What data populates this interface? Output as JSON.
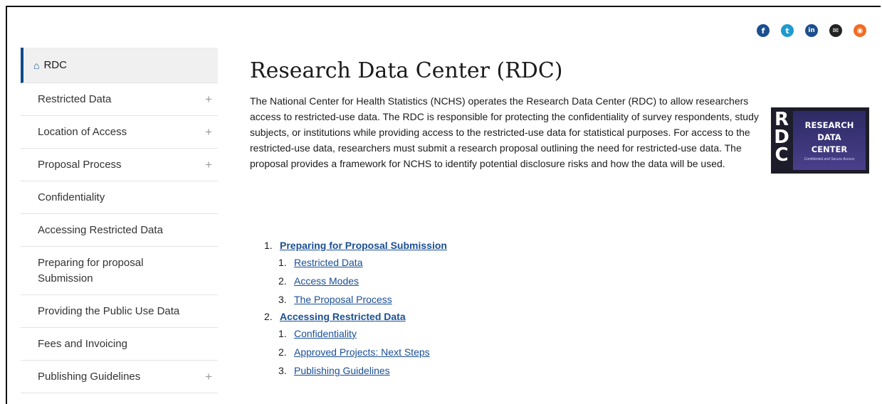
{
  "share": {
    "icons": [
      "facebook-icon",
      "twitter-icon",
      "linkedin-icon",
      "email-icon",
      "rss-icon"
    ]
  },
  "sidebar": {
    "items": [
      {
        "label": "RDC",
        "active": true,
        "expandable": false
      },
      {
        "label": "Restricted Data",
        "active": false,
        "expandable": true
      },
      {
        "label": "Location of Access",
        "active": false,
        "expandable": true
      },
      {
        "label": "Proposal Process",
        "active": false,
        "expandable": true
      },
      {
        "label": "Confidentiality",
        "active": false,
        "expandable": false
      },
      {
        "label": "Accessing Restricted Data",
        "active": false,
        "expandable": false
      },
      {
        "label": "Preparing for proposal Submission",
        "active": false,
        "expandable": false
      },
      {
        "label": "Providing the Public Use Data",
        "active": false,
        "expandable": false
      },
      {
        "label": "Fees and Invoicing",
        "active": false,
        "expandable": false
      },
      {
        "label": "Publishing Guidelines",
        "active": false,
        "expandable": true
      }
    ],
    "plus_symbol": "+"
  },
  "main": {
    "title": "Research Data Center (RDC)",
    "intro": "The National Center for Health Statistics (NCHS) operates the Research Data Center (RDC) to allow researchers access to restricted-use data. The RDC is responsible for protecting the confidentiality of survey respondents, study subjects, or institutions while providing access to the restricted-use data for statistical purposes. For access to the restricted-use data, researchers must submit a research proposal outlining the need for restricted-use data. The proposal provides a framework for NCHS to identify potential disclosure risks and how the data will be used.",
    "badge": {
      "letters": [
        "R",
        "D",
        "C"
      ],
      "line1": "RESEARCH",
      "line2": "DATA",
      "line3": "CENTER",
      "subtitle": "Confidential and Secure Access"
    },
    "toc": [
      {
        "num": "1.",
        "label": "Preparing for Proposal Submission",
        "children": [
          {
            "num": "1.",
            "label": "Restricted Data"
          },
          {
            "num": "2.",
            "label": "Access Modes"
          },
          {
            "num": "3.",
            "label": "The Proposal Process"
          }
        ]
      },
      {
        "num": "2.",
        "label": "Accessing Restricted Data",
        "children": [
          {
            "num": "1.",
            "label": "Confidentiality"
          },
          {
            "num": "2.",
            "label": "Approved Projects: Next Steps"
          },
          {
            "num": "3.",
            "label": "Publishing Guidelines"
          }
        ]
      }
    ]
  }
}
